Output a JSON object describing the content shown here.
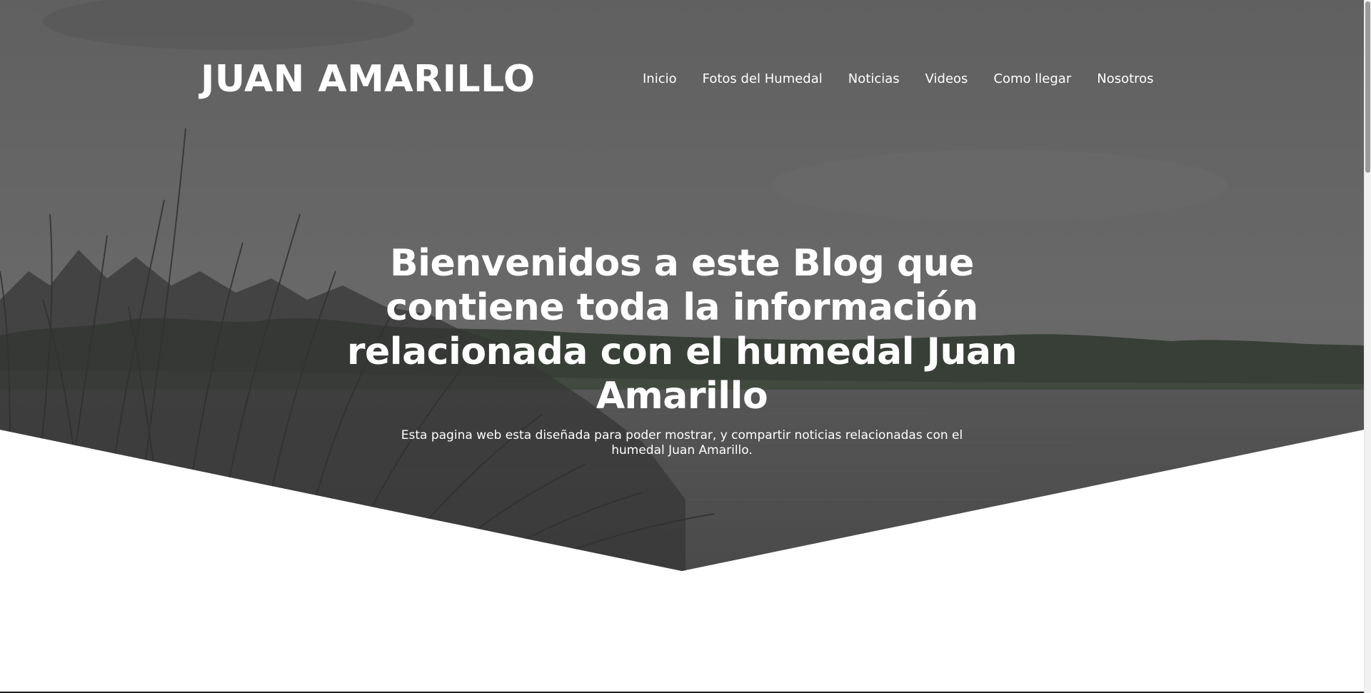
{
  "brand": {
    "title": "JUAN AMARILLO"
  },
  "nav": {
    "items": [
      {
        "label": "Inicio"
      },
      {
        "label": "Fotos del Humedal"
      },
      {
        "label": "Noticias"
      },
      {
        "label": "Videos"
      },
      {
        "label": "Como llegar"
      },
      {
        "label": "Nosotros"
      }
    ]
  },
  "hero": {
    "title": "Bienvenidos a este Blog que contiene toda la información relacionada con el humedal Juan Amarillo",
    "subtitle": "Esta pagina web esta diseñada para poder mostrar, y compartir noticias relacionadas con el humedal Juan Amarillo.",
    "background": "wetland-lake-photo"
  },
  "colors": {
    "overlay": "#5a5a5a",
    "text": "#ffffff",
    "page_background": "#ffffff"
  }
}
